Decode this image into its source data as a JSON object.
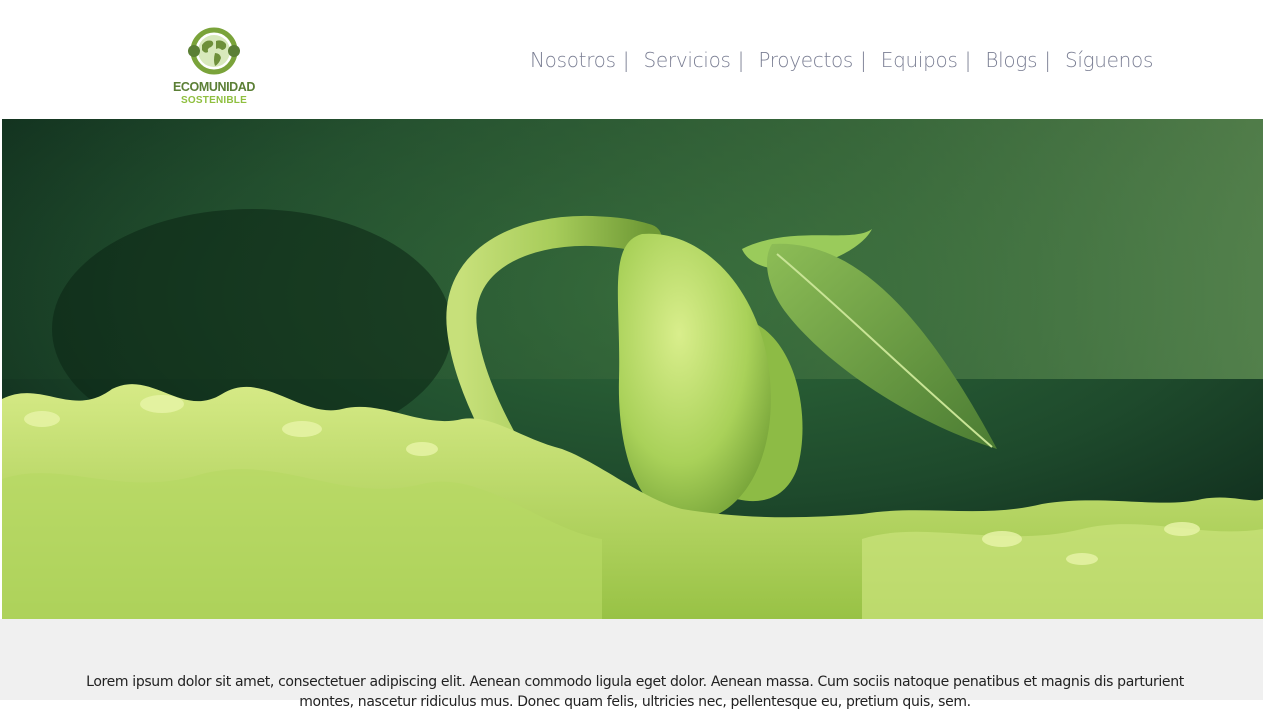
{
  "brand": {
    "name_line1": "ECOMUNIDAD",
    "name_line2": "SOSTENIBLE",
    "logo_icon": "globe-leaf-icon",
    "colors": {
      "dark_green": "#5b7f35",
      "light_green": "#8fbf3f"
    }
  },
  "nav": {
    "items": [
      {
        "label": "Nosotros",
        "sep": "|"
      },
      {
        "label": "Servicios",
        "sep": "|"
      },
      {
        "label": "Proyectos",
        "sep": "|"
      },
      {
        "label": "Equipos",
        "sep": "|"
      },
      {
        "label": "Blogs",
        "sep": "|"
      },
      {
        "label": "Síguenos",
        "sep": ""
      }
    ],
    "text_color": "#7b7f94"
  },
  "hero": {
    "image": "sprouting-seedling-on-moss"
  },
  "content": {
    "paragraph": "Lorem ipsum dolor sit amet, consectetuer adipiscing elit. Aenean commodo ligula eget dolor. Aenean massa. Cum sociis natoque penatibus et magnis dis parturient montes, nascetur ridiculus mus. Donec quam felis, ultricies nec, pellentesque eu, pretium quis, sem.",
    "background": "#f0f0f0"
  }
}
